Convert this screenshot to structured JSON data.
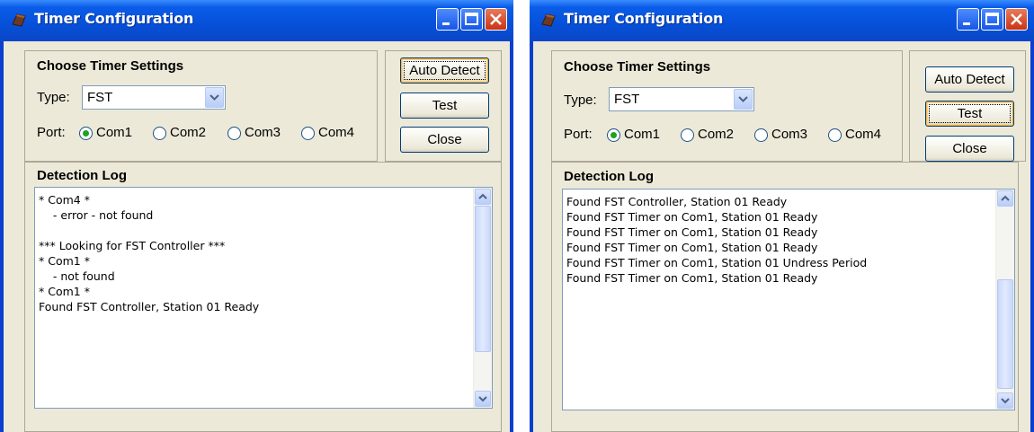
{
  "colors": {
    "titlebar": "#0650d8",
    "client": "#ece9d8",
    "radio_dot": "#21a121"
  },
  "windows": [
    {
      "title": "Timer Configuration",
      "settings_header": "Choose Timer Settings",
      "type_label": "Type:",
      "type_value": "FST",
      "port_label": "Port:",
      "ports": [
        "Com1",
        "Com2",
        "Com3",
        "Com4"
      ],
      "selected_port": "Com1",
      "buttons": {
        "auto_detect": "Auto Detect",
        "test": "Test",
        "close": "Close"
      },
      "focused_button": "Auto Detect",
      "log_header": "Detection Log",
      "log_lines": [
        "* Com4 *",
        "    - error - not found",
        "",
        "*** Looking for FST Controller ***",
        "* Com1 *",
        "    - not found",
        "* Com1 *",
        "Found FST Controller, Station 01 Ready"
      ]
    },
    {
      "title": "Timer Configuration",
      "settings_header": "Choose Timer Settings",
      "type_label": "Type:",
      "type_value": "FST",
      "port_label": "Port:",
      "ports": [
        "Com1",
        "Com2",
        "Com3",
        "Com4"
      ],
      "selected_port": "Com1",
      "buttons": {
        "auto_detect": "Auto Detect",
        "test": "Test",
        "close": "Close"
      },
      "focused_button": "Test",
      "log_header": "Detection Log",
      "log_lines": [
        "Found FST Controller, Station 01 Ready",
        "Found FST Timer on Com1, Station 01 Ready",
        "Found FST Timer on Com1, Station 01 Ready",
        "Found FST Timer on Com1, Station 01 Ready",
        "Found FST Timer on Com1, Station 01 Undress Period",
        "Found FST Timer on Com1, Station 01 Ready"
      ]
    }
  ]
}
